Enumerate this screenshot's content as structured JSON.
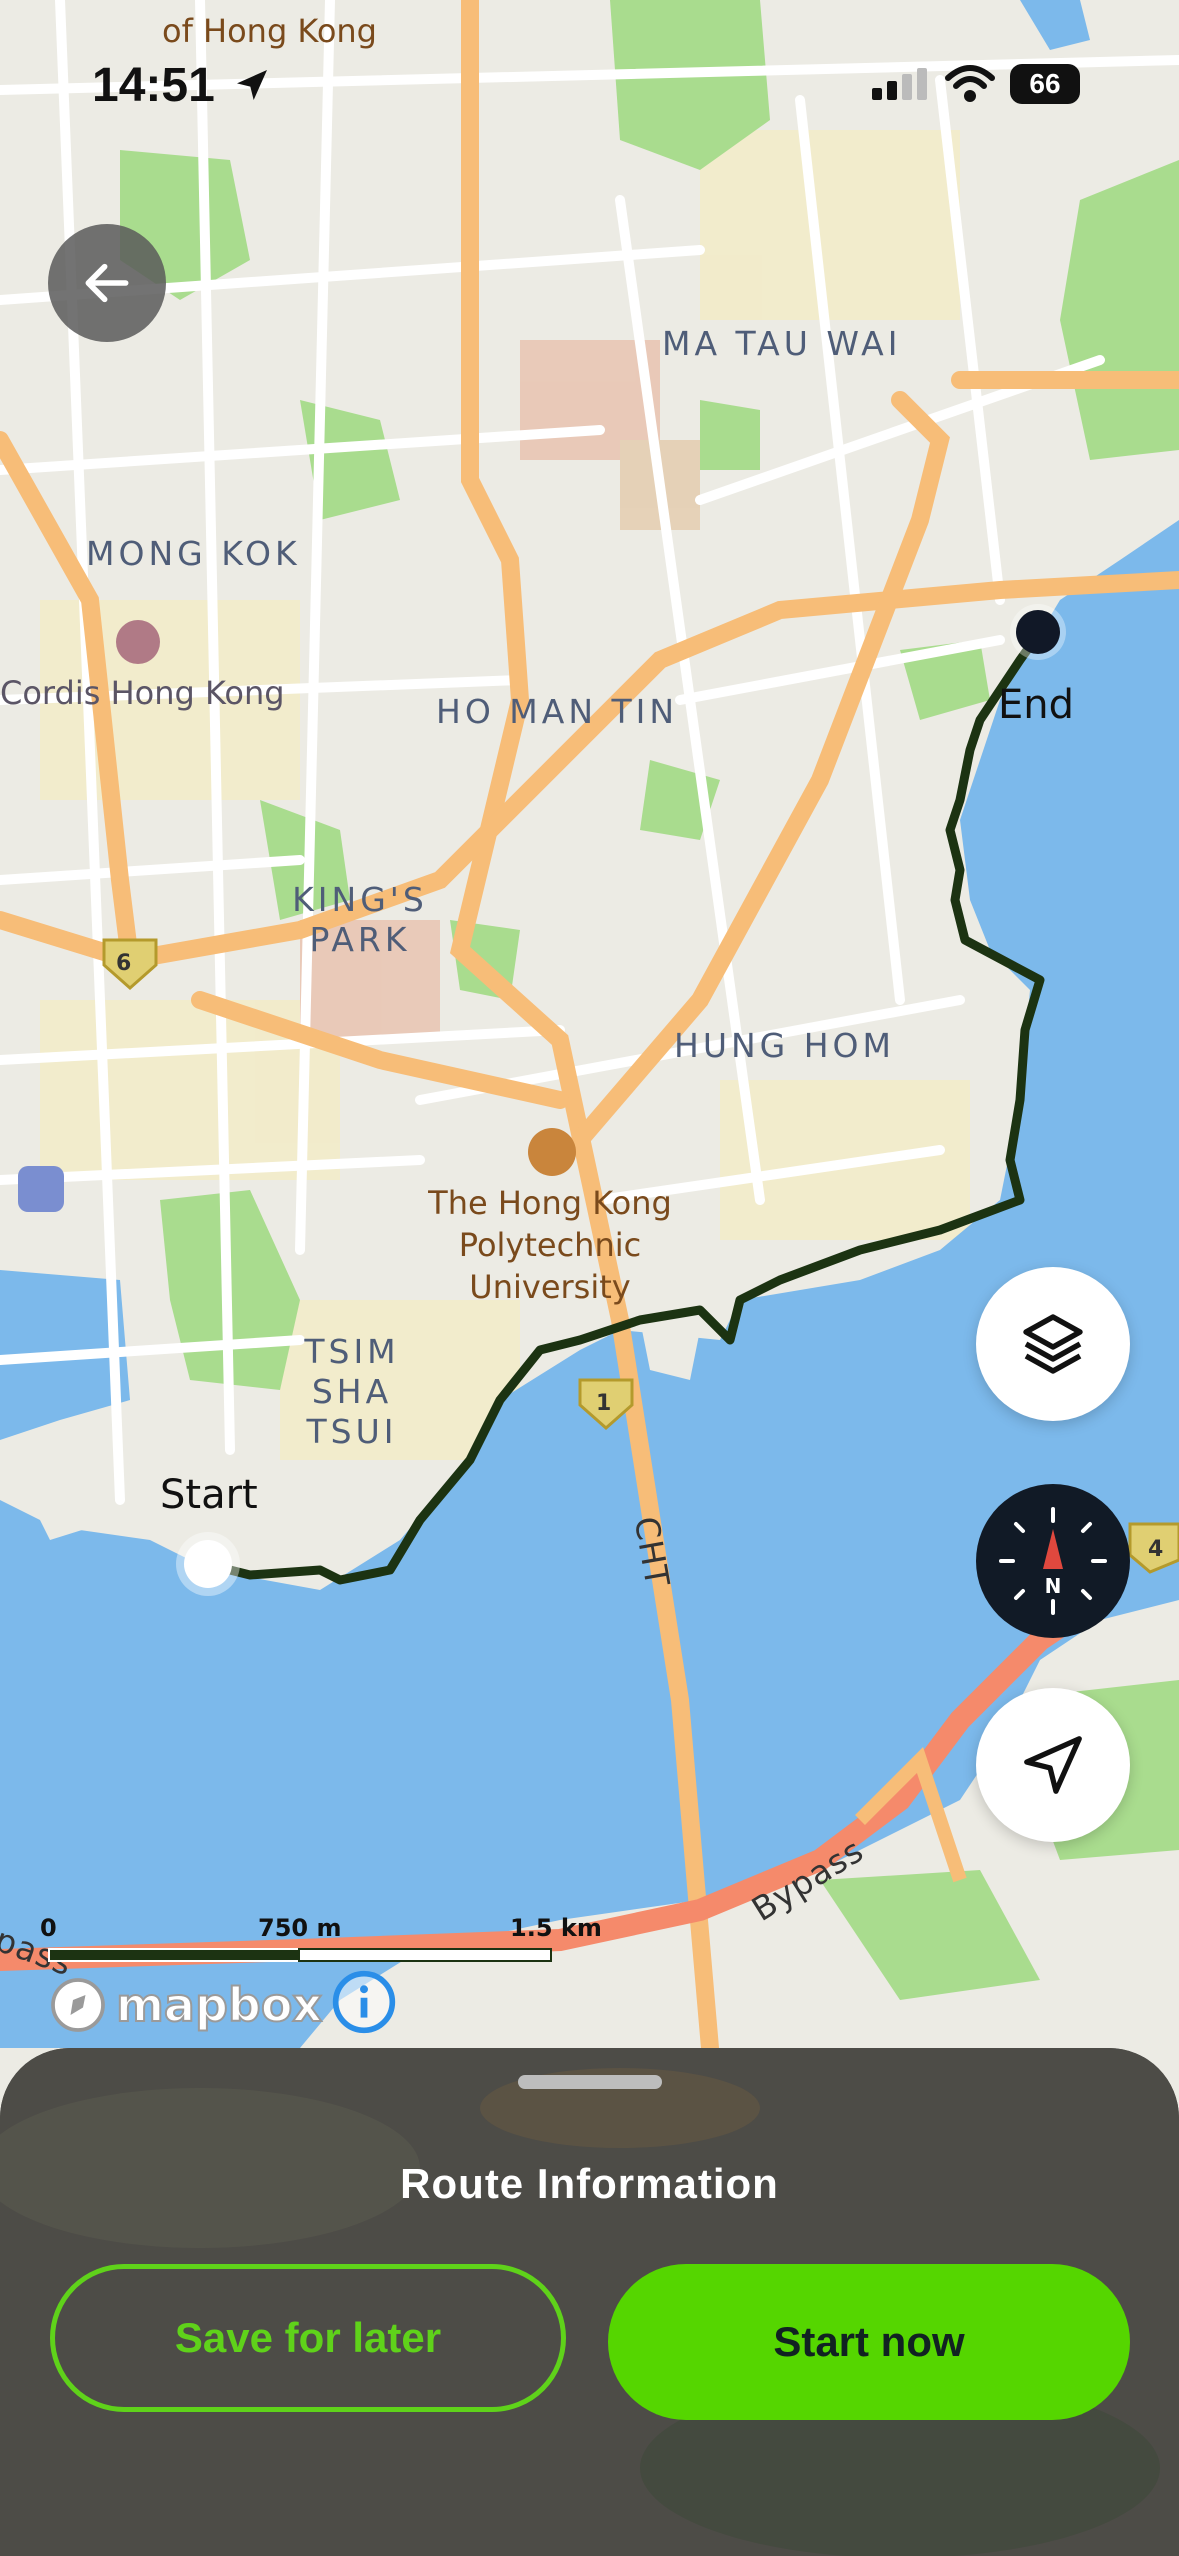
{
  "status_bar": {
    "time": "14:51",
    "battery": "66"
  },
  "map": {
    "labels": {
      "top_partial": "of Hong Kong",
      "ma_tau_wai": "MA TAU WAI",
      "mong_kok": "MONG KOK",
      "cordis": "Cordis Hong Kong",
      "ho_man_tin": "HO MAN TIN",
      "kings_park_1": "KING'S",
      "kings_park_2": "PARK",
      "hung_hom": "HUNG HOM",
      "polyu_1": "The Hong Kong",
      "polyu_2": "Polytechnic University",
      "tst_1": "TSIM SHA",
      "tst_2": "TSUI",
      "cht": "CHT",
      "bypass": "Bypass",
      "pass": "pass",
      "route_6": "6",
      "route_1": "1",
      "route_4": "4"
    },
    "start_label": "Start",
    "end_label": "End",
    "scale": {
      "zero": "0",
      "mid": "750 m",
      "end": "1.5 km"
    },
    "attribution": "mapbox"
  },
  "icons": {
    "back": "arrow-left-icon",
    "layers": "layers-icon",
    "compass": "compass-icon",
    "locate": "location-arrow-icon",
    "info": "info-icon"
  },
  "sheet": {
    "title": "Route Information",
    "save_label": "Save for later",
    "start_label": "Start now"
  },
  "colors": {
    "water": "#7cb9eb",
    "road_major": "#f7bd78",
    "route_line": "#1c3312",
    "accent_green": "#55d600",
    "sheet_bg": "#4a4a46"
  }
}
